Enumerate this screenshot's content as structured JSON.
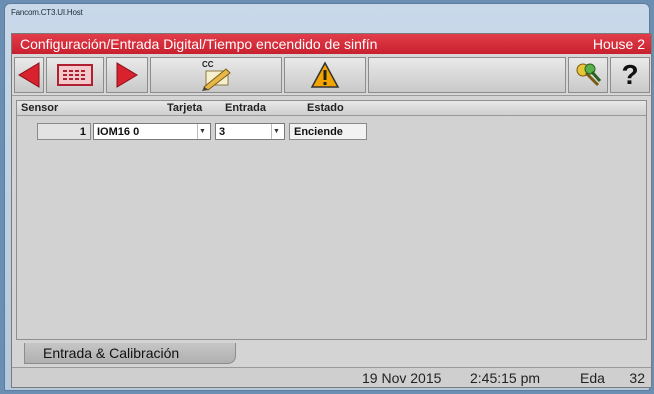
{
  "window": {
    "title": "Fancom.CT3.UI.Host"
  },
  "header": {
    "title": "Configuración/Entrada Digital/Tiempo encendido de sinfín",
    "house": "House 2"
  },
  "toolbar": {
    "back_icon": "left-arrow-icon",
    "menu_icon": "list-icon",
    "forward_icon": "right-arrow-icon",
    "copy_label": "CC",
    "copy_icon": "copy-pencil-icon",
    "alarm_icon": "warning-icon",
    "keys_icon": "keys-icon",
    "help_label": "?",
    "colors": {
      "arrow": "#d8232f",
      "warning": "#f2a500"
    }
  },
  "table": {
    "headers": {
      "sensor": "Sensor",
      "card": "Tarjeta",
      "input": "Entrada",
      "status": "Estado"
    },
    "rows": [
      {
        "sensor": "1",
        "card": "IOM16 0",
        "input": "3",
        "status": "Enciende"
      }
    ]
  },
  "tabs": [
    {
      "label": "Entrada & Calibración",
      "active": true
    }
  ],
  "statusbar": {
    "date": "19 Nov 2015",
    "time": "2:45:15 pm",
    "label": "Eda",
    "value": "32"
  }
}
